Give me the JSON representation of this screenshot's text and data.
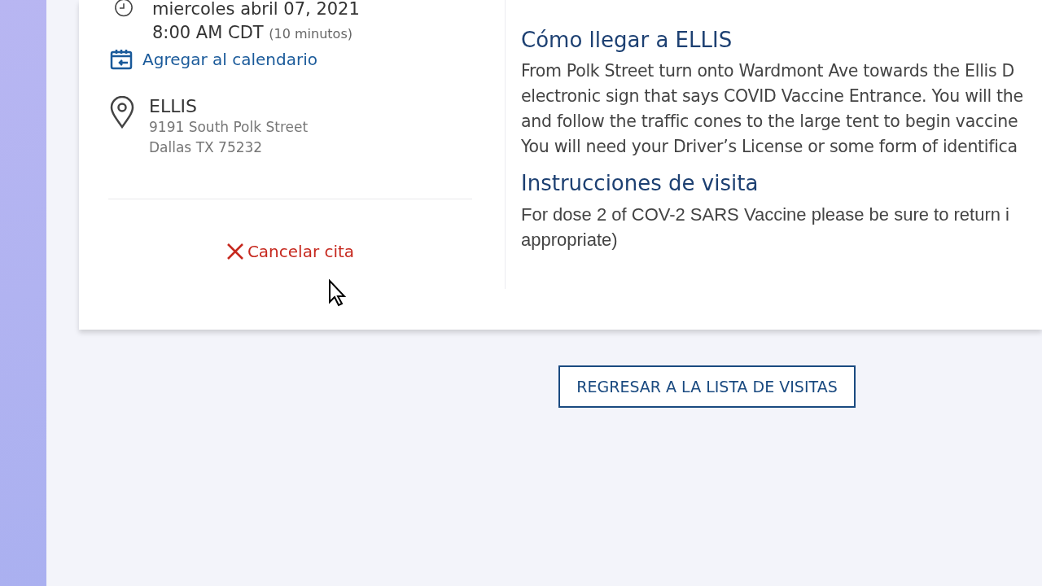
{
  "appointment": {
    "date": "miercoles abril 07, 2021",
    "time": "8:00 AM CDT",
    "duration": "(10 minutos)",
    "add_to_calendar": "Agregar al calendario"
  },
  "location": {
    "name": "ELLIS",
    "address_lines": [
      "9191 South Polk Street",
      "Dallas TX 75232"
    ]
  },
  "cancel_link": "Cancelar cita",
  "sections": [
    {
      "heading": "Cómo llegar a ELLIS",
      "kind": "directions",
      "lines": [
        "From Polk Street turn onto Wardmont Ave towards the Ellis D",
        "electronic sign that says COVID Vaccine Entrance. You will the",
        "and follow the traffic cones to the large tent to begin vaccine",
        "You will need your Driver’s License or some form of identifica"
      ]
    },
    {
      "heading": "Instrucciones de visita",
      "kind": "instructions",
      "lines": [
        "For dose 2 of COV-2 SARS Vaccine please be sure to return i",
        "appropriate)"
      ]
    }
  ],
  "back_button": "REGRESAR A LA LISTA DE VISITAS"
}
